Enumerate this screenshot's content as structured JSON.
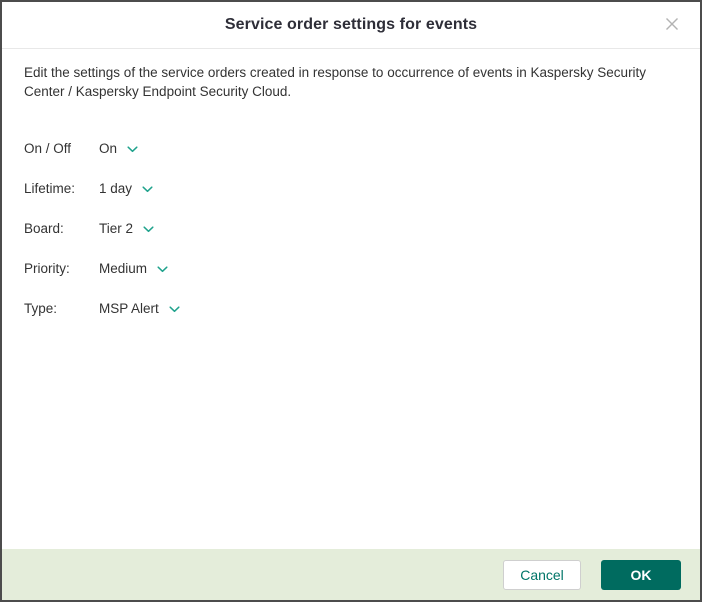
{
  "dialog": {
    "title": "Service order settings for events",
    "description": "Edit the settings of the service orders created in response to occurrence of events in Kaspersky Security Center / Kaspersky Endpoint Security Cloud.",
    "fields": [
      {
        "label": "On / Off",
        "value": "On"
      },
      {
        "label": "Lifetime:",
        "value": "1 day"
      },
      {
        "label": "Board:",
        "value": "Tier 2"
      },
      {
        "label": "Priority:",
        "value": "Medium"
      },
      {
        "label": "Type:",
        "value": "MSP Alert"
      }
    ],
    "footer": {
      "cancel_label": "Cancel",
      "ok_label": "OK"
    },
    "icons": {
      "close": "close-x",
      "dropdown": "chevron-down"
    },
    "colors": {
      "accent_teal": "#006b5f",
      "cancel_text": "#007568",
      "chevron_green": "#1fa28c",
      "footer_bg": "#e4edda",
      "close_gray": "#b3b3b3"
    }
  }
}
